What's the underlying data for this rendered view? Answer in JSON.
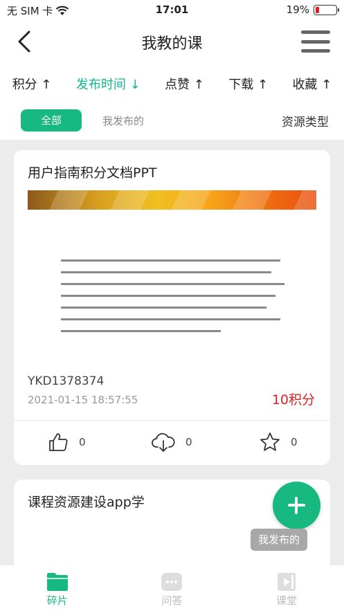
{
  "status": {
    "carrier": "无 SIM 卡",
    "time": "17:01",
    "battery": "19%",
    "battery_level": 0.19,
    "battery_color": "#e02020"
  },
  "nav": {
    "title": "我教的课",
    "back_icon": "chevron-left-icon",
    "menu_icon": "hamburger-menu-icon"
  },
  "sort": {
    "items": [
      {
        "label": "积分 ↑"
      },
      {
        "label": "发布时间 ↓",
        "active": true
      },
      {
        "label": "点赞 ↑"
      },
      {
        "label": "下载 ↑"
      },
      {
        "label": "收藏 ↑"
      }
    ],
    "active_color": "#10b98a"
  },
  "filter": {
    "all": "全部",
    "mine": "我发布的",
    "resource_type": "资源类型"
  },
  "cards": [
    {
      "title": "用户指南积分文档PPT",
      "code": "YKD1378374",
      "date": "2021-01-15 18:57:55",
      "points": "10积分",
      "likes": "0",
      "downloads": "0",
      "favorites": "0"
    },
    {
      "title": "课程资源建设app学"
    }
  ],
  "fab": {
    "icon": "plus-icon",
    "tooltip": "我发布的"
  },
  "tabbar": {
    "items": [
      {
        "label": "碎片",
        "icon": "folder-icon",
        "active": true
      },
      {
        "label": "问答",
        "icon": "chat-icon"
      },
      {
        "label": "课堂",
        "icon": "video-icon"
      }
    ],
    "accent": "#17b981"
  }
}
